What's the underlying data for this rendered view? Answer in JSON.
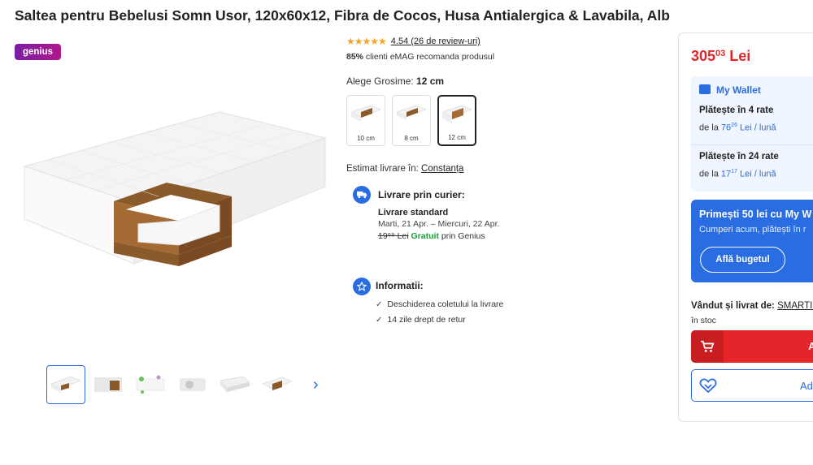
{
  "product": {
    "title": "Saltea pentru Bebelusi Somn Usor, 120x60x12, Fibra de Cocos, Husa Antialergica & Lavabila, Alb"
  },
  "badges": {
    "genius": "genius"
  },
  "rating": {
    "stars": "★★★★★",
    "text": "4.54 (26 de review-uri)",
    "recommend_pct": "85%",
    "recommend_text": " clienti eMAG recomanda produsul"
  },
  "thickness": {
    "label": "Alege Grosime: ",
    "selected": "12 cm",
    "options": [
      "10 cm",
      "8 cm",
      "12 cm"
    ]
  },
  "delivery": {
    "estimate_label": "Estimat livrare în: ",
    "location": "Constanța",
    "courier_title": "Livrare prin curier:",
    "standard": "Livrare standard",
    "dates": "Marti, 21 Apr. – Miercuri, 22 Apr.",
    "old_price": "19⁹⁹ Lei",
    "free": "Gratuit",
    "via": " prin Genius"
  },
  "info": {
    "title": "Informatii:",
    "items": [
      "Deschiderea coletului la livrare",
      "14 zile drept de retur"
    ]
  },
  "buy": {
    "price_main": "305",
    "price_cents": "03",
    "currency": " Lei",
    "wallet_title": "My Wallet",
    "rate1_title": "Plătește în 4 rate",
    "rate1_prefix": "de la ",
    "rate1_amount": "76",
    "rate1_cents": "26",
    "rate1_suffix": " Lei / lună",
    "rate2_title": "Plătește în 24 rate",
    "rate2_prefix": "de la ",
    "rate2_amount": "17",
    "rate2_cents": "17",
    "rate2_suffix": " Lei / lună",
    "promo_title": "Primești 50 lei cu My W",
    "promo_sub": "Cumperi acum, plătești în r",
    "promo_button": "Află bugetul",
    "seller_label": "Vândut și livrat de: ",
    "seller_name": "SMARTIC",
    "stock": "în stoc",
    "cart_label": "A",
    "fav_label": "Ad"
  },
  "colors": {
    "accent": "#2a6de2",
    "price": "#e4262a",
    "free": "#1f9d3a",
    "genius": "#9b1c98"
  },
  "icons": {
    "thumb_next": "chevron-right-icon",
    "shipping": "truck-icon",
    "info": "star-icon",
    "wallet": "wallet-icon",
    "cart": "cart-icon",
    "favorite": "heart-icon"
  }
}
